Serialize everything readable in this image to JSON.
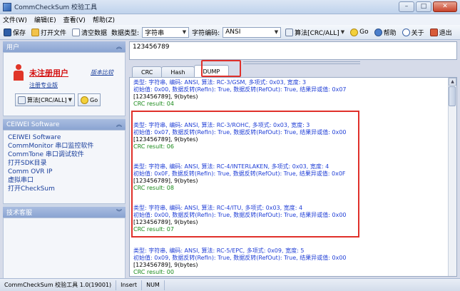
{
  "window": {
    "title": "CommCheckSum 校验工具"
  },
  "menu": [
    "文件(W)",
    "编辑(E)",
    "查看(V)",
    "帮助(Z)"
  ],
  "toolbar": {
    "save": "保存",
    "open": "打开文件",
    "clear": "清空数据",
    "data_type_label": "数据类型:",
    "data_type_value": "字符串",
    "encoding_label": "字符编码:",
    "encoding_value": "ANSI",
    "algo": "算法[CRC/ALL]",
    "go": "Go",
    "help": "帮助",
    "about": "关于",
    "exit": "退出"
  },
  "left": {
    "user_header": "用户",
    "user_title": "未注册用户",
    "user_link": "版本比较",
    "register_link": "注册专业版",
    "mini_algo": "算法[CRC/ALL]",
    "mini_go": "Go",
    "software_header": "CEIWEI Software",
    "software_items": [
      "CEIWEI Software",
      "CommMonitor 串口监控软件",
      "CommTone 串口调试软件",
      "打开SDK目录",
      "Comm OVR IP",
      "虚拟串口",
      "打开CheckSum"
    ],
    "support_header": "技术客服"
  },
  "input": {
    "value": "123456789"
  },
  "tabs": [
    "CRC",
    "Hash",
    "DUMP"
  ],
  "output": {
    "records": [
      {
        "line1": "类型: 字符串, 编码: ANSI, 算法: RC-3/GSM, 多项式: 0x03, 宽度: 3",
        "line2": "初始值: 0x00, 数据反转(RefIn): True, 数据反转(RefOut): True, 结果异或值: 0x07",
        "line3": "[123456789], 9(bytes)",
        "line4": "CRC result: 04"
      },
      {
        "line1": "类型: 字符串, 编码: ANSI, 算法: RC-3/ROHC, 多项式: 0x03, 宽度: 3",
        "line2": "初始值: 0x07, 数据反转(RefIn): True, 数据反转(RefOut): True, 结果异或值: 0x00",
        "line3": "[123456789], 9(bytes)",
        "line4": "CRC result: 06"
      },
      {
        "line1": "类型: 字符串, 编码: ANSI, 算法: RC-4/INTERLAKEN, 多项式: 0x03, 宽度: 4",
        "line2": "初始值: 0x0F, 数据反转(RefIn): True, 数据反转(RefOut): True, 结果异或值: 0x0F",
        "line3": "[123456789], 9(bytes)",
        "line4": "CRC result: 08"
      },
      {
        "line1": "类型: 字符串, 编码: ANSI, 算法: RC-4/ITU, 多项式: 0x03, 宽度: 4",
        "line2": "初始值: 0x00, 数据反转(RefIn): True, 数据反转(RefOut): True, 结果异或值: 0x00",
        "line3": "[123456789], 9(bytes)",
        "line4": "CRC result: 07"
      },
      {
        "line1": "类型: 字符串, 编码: ANSI, 算法: RC-5/EPC, 多项式: 0x09, 宽度: 5",
        "line2": "初始值: 0x09, 数据反转(RefIn): True, 数据反转(RefOut): True, 结果异或值: 0x00",
        "line3": "[123456789], 9(bytes)",
        "line4": "CRC result: 00"
      }
    ]
  },
  "status": {
    "version": "CommCheckSum 校验工具 1.0(19001)",
    "insert": "Insert",
    "num": "NUM"
  },
  "colors": {
    "highlight": "#e0302a",
    "record_text": "#1f3ed6",
    "result_text": "#1a8a1a",
    "user_title": "#d41010"
  }
}
